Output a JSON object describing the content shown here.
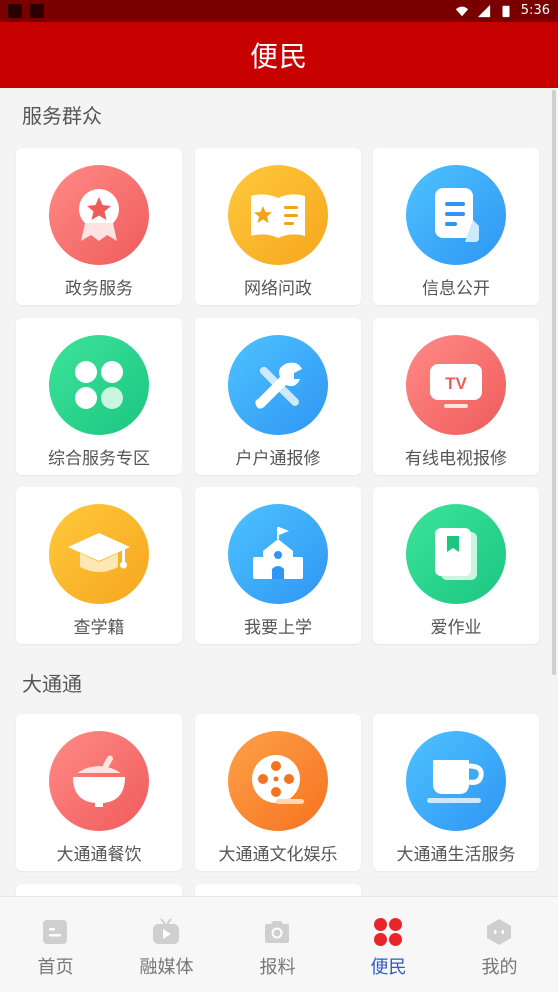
{
  "status_bar": {
    "time": "5:36"
  },
  "header": {
    "title": "便民"
  },
  "sections": [
    {
      "title": "服务群众",
      "items": [
        {
          "label": "政务服务",
          "icon": "award-badge-icon",
          "color": "#f46b68"
        },
        {
          "label": "网络问政",
          "icon": "open-book-icon",
          "color": "#f8b12a"
        },
        {
          "label": "信息公开",
          "icon": "document-icon",
          "color": "#37a8f8"
        },
        {
          "label": "综合服务专区",
          "icon": "clover-icon",
          "color": "#26d48b"
        },
        {
          "label": "户户通报修",
          "icon": "repair-tools-icon",
          "color": "#37a8f8"
        },
        {
          "label": "有线电视报修",
          "icon": "tv-icon",
          "color": "#f46b68"
        },
        {
          "label": "查学籍",
          "icon": "graduation-cap-icon",
          "color": "#f8b12a"
        },
        {
          "label": "我要上学",
          "icon": "school-icon",
          "color": "#37a8f8"
        },
        {
          "label": "爱作业",
          "icon": "notebook-icon",
          "color": "#26d48b"
        }
      ]
    },
    {
      "title": "大通通",
      "items": [
        {
          "label": "大通通餐饮",
          "icon": "food-bowl-icon",
          "color": "#f46b68"
        },
        {
          "label": "大通通文化娱乐",
          "icon": "film-reel-icon",
          "color": "#f7862d"
        },
        {
          "label": "大通通生活服务",
          "icon": "coffee-cup-icon",
          "color": "#37a8f8"
        }
      ]
    }
  ],
  "bottom_nav": {
    "items": [
      {
        "label": "首页",
        "icon": "home-icon"
      },
      {
        "label": "融媒体",
        "icon": "media-icon"
      },
      {
        "label": "报料",
        "icon": "camera-icon"
      },
      {
        "label": "便民",
        "icon": "clover-icon",
        "active": true
      },
      {
        "label": "我的",
        "icon": "profile-icon"
      }
    ],
    "active_color": "#2a5cc8",
    "active_icon_color": "#e8262a"
  }
}
